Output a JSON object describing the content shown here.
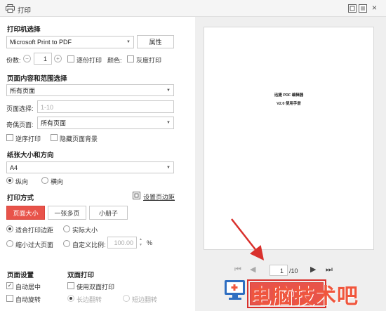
{
  "window": {
    "title": "打印"
  },
  "printer": {
    "section_title": "打印机选择",
    "selected": "Microsoft Print to PDF",
    "properties_label": "属性",
    "copies_label": "份数:",
    "copies_value": "1",
    "minus": "−",
    "plus": "+",
    "collate_label": "逐份打印",
    "color_label": "颜色:",
    "grayscale_label": "灰度打印"
  },
  "range": {
    "section_title": "页面内容和范围选择",
    "content_selected": "所有页面",
    "page_select_label": "页面选择:",
    "page_select_placeholder": "1-10",
    "odd_even_label": "奇偶页面:",
    "odd_even_selected": "所有页面",
    "reverse_label": "逆序打印",
    "hide_bg_label": "隐藏页面背景"
  },
  "paper": {
    "section_title": "纸张大小和方向",
    "size_selected": "A4",
    "portrait_label": "纵向",
    "landscape_label": "横向"
  },
  "mode": {
    "section_title": "打印方式",
    "set_margins_label": "设置页边距",
    "tabs": [
      "页面大小",
      "一张多页",
      "小册子"
    ],
    "fit_margins_label": "适合打印边距",
    "actual_size_label": "实际大小",
    "shrink_label": "缩小过大页面",
    "custom_scale_label": "自定义比例:",
    "custom_scale_value": "100.00",
    "percent": "%"
  },
  "page_settings": {
    "section_title": "页面设置",
    "auto_center_label": "自动居中",
    "auto_rotate_label": "自动旋转"
  },
  "duplex": {
    "section_title": "双面打印",
    "use_duplex_label": "使用双面打印",
    "long_edge_label": "长边翻转",
    "short_edge_label": "短边翻转"
  },
  "preview": {
    "doc_title": "迅捷 PDF 编辑器",
    "doc_subtitle": "V2.0 使用手册",
    "current_page": "1",
    "total_pages": "/10"
  },
  "actions": {
    "print_label": "打印"
  },
  "watermark": {
    "text": "电脑技术吧"
  },
  "colors": {
    "accent": "#e8534a",
    "annotation_red": "#d9302c",
    "watermark": "#f0563d"
  }
}
